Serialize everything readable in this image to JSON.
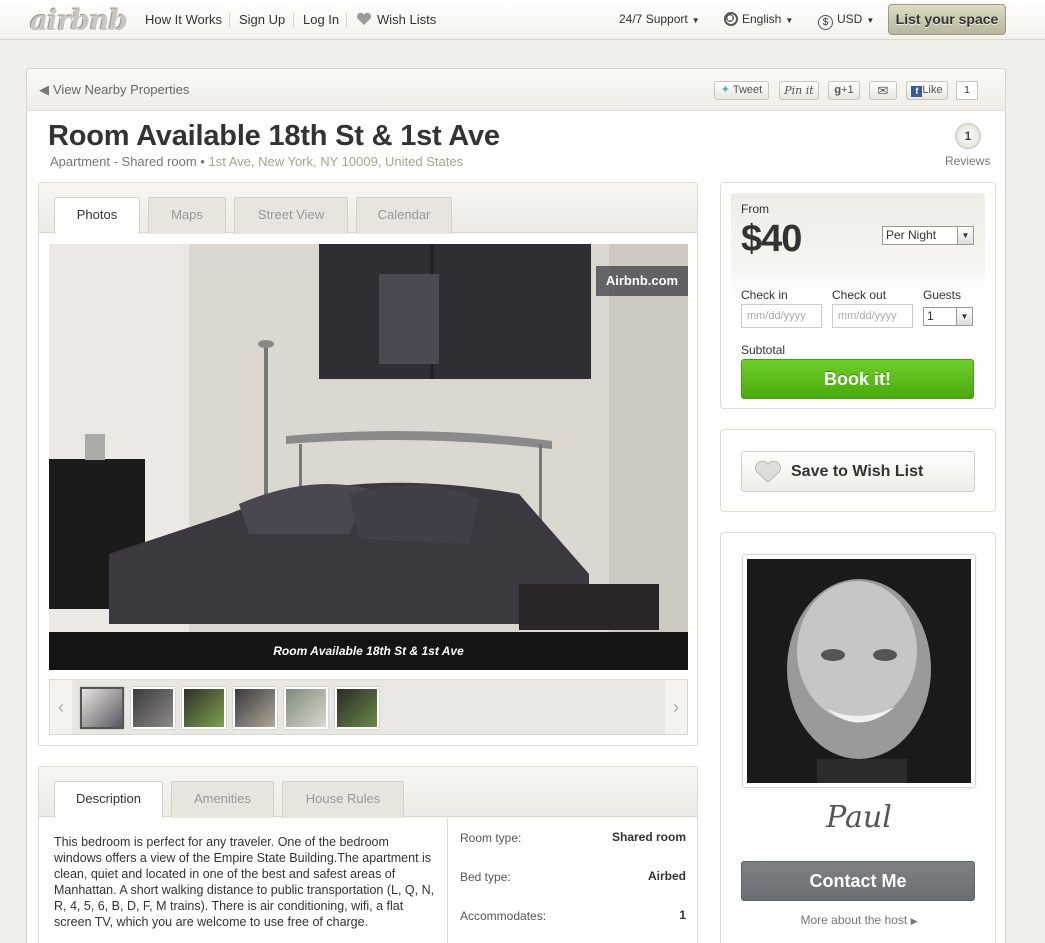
{
  "nav": {
    "logo": "airbnb",
    "links": [
      "How It Works",
      "Sign Up",
      "Log In",
      "Wish Lists"
    ],
    "support": "24/7 Support",
    "language": "English",
    "currency": "USD",
    "list_space": "List your space"
  },
  "subbar": {
    "nearby": "View Nearby Properties",
    "tweet": "Tweet",
    "pinit": "Pin it",
    "gplus": "+1",
    "like": "Like",
    "like_count": "1"
  },
  "listing": {
    "title": "Room Available 18th St & 1st Ave",
    "room_type_line": "Apartment - Shared room",
    "address": "1st Ave, New York, NY 10009, United States",
    "reviews_count": "1",
    "reviews_label": "Reviews"
  },
  "photos": {
    "tabs": [
      "Photos",
      "Maps",
      "Street View",
      "Calendar"
    ],
    "watermark": "Airbnb.com",
    "caption": "Room Available 18th St & 1st Ave"
  },
  "description": {
    "tabs": [
      "Description",
      "Amenities",
      "House Rules"
    ],
    "text": "This bedroom is perfect for any traveler. One of the bedroom windows offers a view of the Empire State Building.The apartment is clean, quiet and located in one of the best and safest areas of Manhattan. A short walking distance to public transportation (L, Q, N, R, 4, 5, 6, B, D, F, M trains). There is air conditioning, wifi, a flat screen TV, which you are welcome to use free of charge.",
    "details": [
      {
        "label": "Room type:",
        "value": "Shared room"
      },
      {
        "label": "Bed type:",
        "value": "Airbed"
      },
      {
        "label": "Accommodates:",
        "value": "1"
      }
    ]
  },
  "booking": {
    "from_label": "From",
    "price": "$40",
    "period": "Per Night",
    "checkin_label": "Check in",
    "checkout_label": "Check out",
    "guests_label": "Guests",
    "date_placeholder": "mm/dd/yyyy",
    "guests_value": "1",
    "subtotal_label": "Subtotal",
    "book_button": "Book it!"
  },
  "wishlist": {
    "button": "Save to Wish List"
  },
  "host": {
    "name": "Paul",
    "contact_button": "Contact Me",
    "more": "More about the host"
  },
  "colors": {
    "book_green": "#5bbf1c",
    "contact_gray": "#747a7c",
    "list_space_bg": "#cac7ad"
  }
}
